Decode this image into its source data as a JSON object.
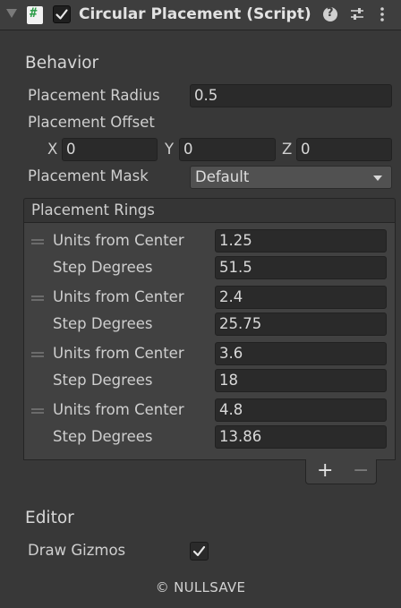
{
  "header": {
    "title": "Circular Placement (Script)",
    "enabled": true,
    "icons": [
      "fold-arrow-icon",
      "script-icon",
      "help-icon",
      "presets-icon",
      "more-options-icon"
    ]
  },
  "behavior": {
    "section_label": "Behavior",
    "placement_radius_label": "Placement Radius",
    "placement_radius_value": "0.5",
    "placement_offset_label": "Placement Offset",
    "offset": {
      "x_label": "X",
      "x_value": "0",
      "y_label": "Y",
      "y_value": "0",
      "z_label": "Z",
      "z_value": "0"
    },
    "placement_mask_label": "Placement Mask",
    "placement_mask_value": "Default"
  },
  "rings": {
    "list_label": "Placement Rings",
    "items": [
      {
        "units_label": "Units from Center",
        "units_value": "1.25",
        "step_label": "Step Degrees",
        "step_value": "51.5"
      },
      {
        "units_label": "Units from Center",
        "units_value": "2.4",
        "step_label": "Step Degrees",
        "step_value": "25.75"
      },
      {
        "units_label": "Units from Center",
        "units_value": "3.6",
        "step_label": "Step Degrees",
        "step_value": "18"
      },
      {
        "units_label": "Units from Center",
        "units_value": "4.8",
        "step_label": "Step Degrees",
        "step_value": "13.86"
      }
    ],
    "add_label": "+",
    "remove_label": "−"
  },
  "editor": {
    "section_label": "Editor",
    "draw_gizmos_label": "Draw Gizmos",
    "draw_gizmos_checked": true
  },
  "footer": {
    "copyright": "© NULLSAVE"
  },
  "colors": {
    "background": "#383838",
    "field_background": "#2a2a2a",
    "dropdown_background": "#515151",
    "script_icon_green": "#2f9e4a"
  }
}
